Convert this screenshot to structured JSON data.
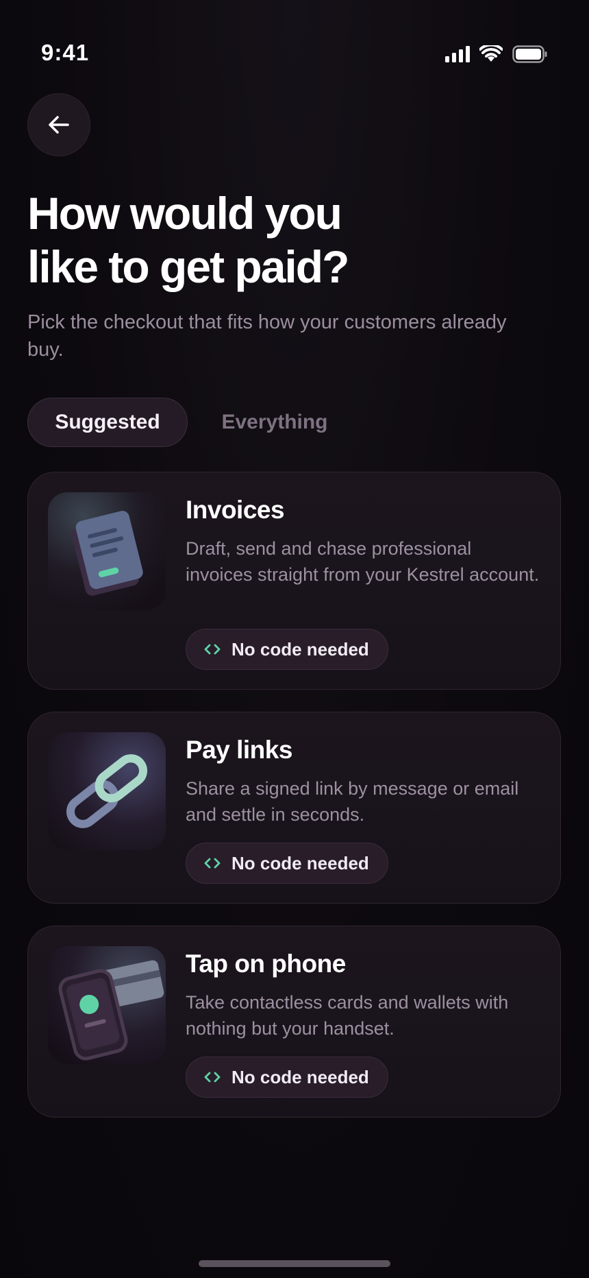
{
  "status_bar": {
    "time": "9:41"
  },
  "header": {
    "title_line1": "How would you",
    "title_line2": "like to get paid?",
    "subtitle": "Pick the checkout that fits how your customers already buy."
  },
  "tabs": [
    {
      "label": "Suggested",
      "active": true
    },
    {
      "label": "Everything",
      "active": false
    }
  ],
  "options": [
    {
      "title": "Invoices",
      "description": "Draft, send and chase professional invoices straight from your Kestrel account.",
      "badge": "No code needed",
      "icon": "invoice-document-icon"
    },
    {
      "title": "Pay links",
      "description": "Share a signed link by message or email and settle in seconds.",
      "badge": "No code needed",
      "icon": "chain-link-icon"
    },
    {
      "title": "Tap on phone",
      "description": "Take contactless cards and wallets with nothing but your handset.",
      "badge": "No code needed",
      "icon": "phone-card-icon"
    }
  ],
  "colors": {
    "accent_green": "#5fd3a6",
    "background": "#0d0a0f",
    "card": "#1a141c"
  }
}
